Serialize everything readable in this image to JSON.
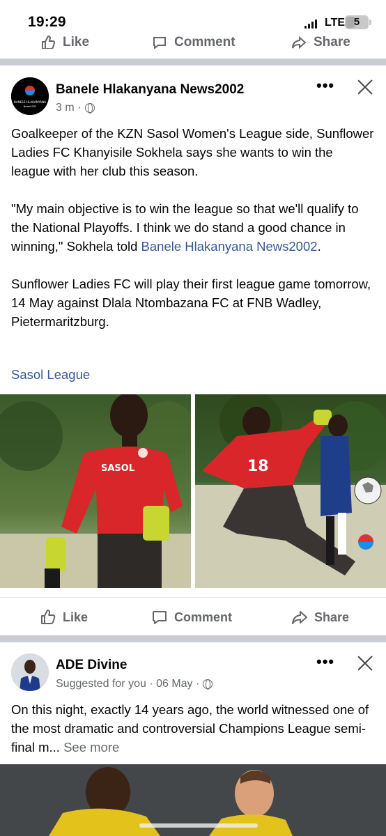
{
  "status_bar": {
    "time": "19:29",
    "network": "LTE",
    "battery": "5"
  },
  "prev_post_actions": [
    "Like",
    "Comment",
    "Share"
  ],
  "post1": {
    "author": "Banele Hlakanyana News2002",
    "avatar_text": "BANELE HLAKANYANA",
    "avatar_subtext": "News2002",
    "time": "3 m",
    "paragraph1": "Goalkeeper of the KZN Sasol Women's League side, Sunflower Ladies FC Khanyisile Sokhela says she wants to win the league with her club this season.",
    "paragraph2_before": "\"My main objective is to win the league so that we'll qualify to the National Playoffs. I think we do stand a good chance in winning,\" Sokhela told ",
    "paragraph2_link": "Banele Hlakanyana News2002",
    "paragraph2_after": ".",
    "paragraph3": "Sunflower Ladies FC will play their first league game tomorrow, 14 May against Dlala Ntombazana FC at FNB Wadley, Pietermaritzburg.",
    "hashtag": "Sasol League",
    "photo_text_sasol": "SASOL",
    "photo_jersey_number": "18",
    "actions": {
      "like": "Like",
      "comment": "Comment",
      "share": "Share"
    }
  },
  "post2": {
    "author": "ADE Divine",
    "meta": "Suggested for you · 06 May ·",
    "text": "On this night, exactly 14 years ago, the world witnessed one of the most dramatic and controversial Champions League semi-final m...",
    "see_more": "See more"
  },
  "colors": {
    "link": "#385898",
    "meta": "#65676b",
    "divider": "#c9ccd1"
  }
}
